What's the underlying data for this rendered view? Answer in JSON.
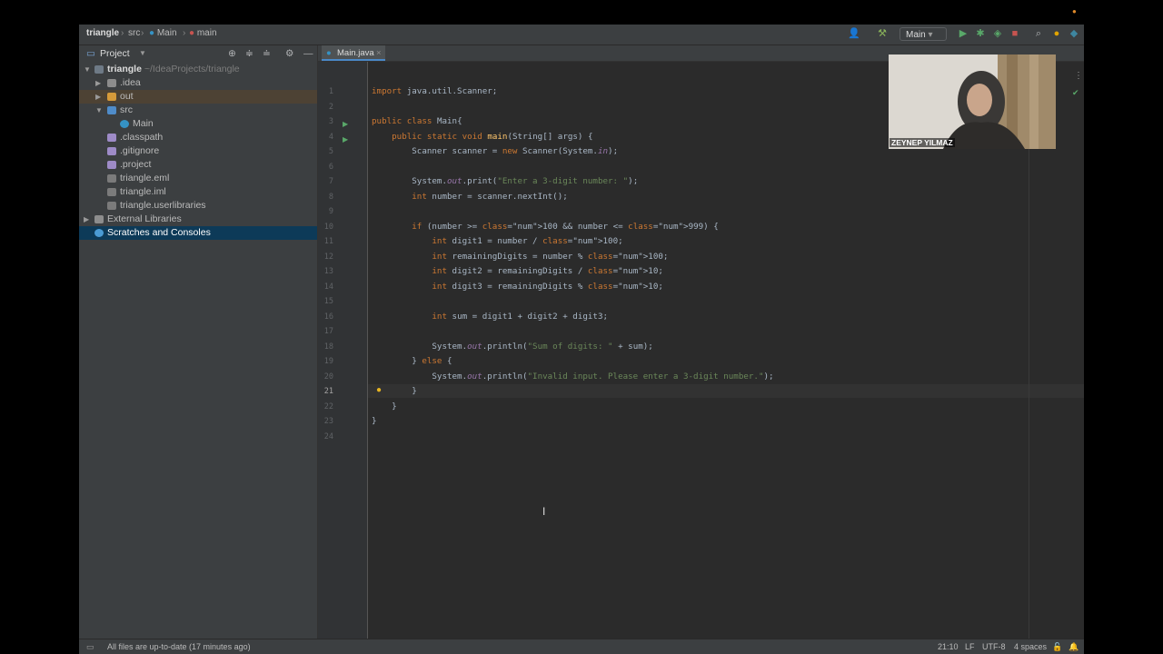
{
  "breadcrumb": {
    "project": "triangle",
    "folder": "src",
    "class": "Main",
    "method": "main"
  },
  "toolbar": {
    "run_config": "Main"
  },
  "sidebar": {
    "title": "Project",
    "items": [
      {
        "label": "triangle",
        "path": "~/IdeaProjects/triangle"
      },
      {
        "label": ".idea"
      },
      {
        "label": "out"
      },
      {
        "label": "src"
      },
      {
        "label": "Main"
      },
      {
        "label": ".classpath"
      },
      {
        "label": ".gitignore"
      },
      {
        "label": ".project"
      },
      {
        "label": "triangle.eml"
      },
      {
        "label": "triangle.iml"
      },
      {
        "label": "triangle.userlibraries"
      },
      {
        "label": "External Libraries"
      },
      {
        "label": "Scratches and Consoles"
      }
    ]
  },
  "editor": {
    "tab": "Main.java",
    "line_numbers": [
      "1",
      "2",
      "3",
      "4",
      "5",
      "6",
      "7",
      "8",
      "9",
      "10",
      "11",
      "12",
      "13",
      "14",
      "15",
      "16",
      "17",
      "18",
      "19",
      "20",
      "21",
      "22",
      "23",
      "24"
    ],
    "lines": [
      "import java.util.Scanner;",
      "",
      "public class Main{",
      "    public static void main(String[] args) {",
      "        Scanner scanner = new Scanner(System.in);",
      "",
      "        System.out.print(\"Enter a 3-digit number: \");",
      "        int number = scanner.nextInt();",
      "",
      "        if (number >= 100 && number <= 999) {",
      "            int digit1 = number / 100;",
      "            int remainingDigits = number % 100;",
      "            int digit2 = remainingDigits / 10;",
      "            int digit3 = remainingDigits % 10;",
      "",
      "            int sum = digit1 + digit2 + digit3;",
      "",
      "            System.out.println(\"Sum of digits: \" + sum);",
      "        } else {",
      "            System.out.println(\"Invalid input. Please enter a 3-digit number.\");",
      "        }",
      "    }",
      "}",
      ""
    ]
  },
  "statusbar": {
    "message": "All files are up-to-date (17 minutes ago)",
    "position": "21:10",
    "line_sep": "LF",
    "encoding": "UTF-8",
    "indent": "4 spaces"
  },
  "webcam": {
    "name": "ZEYNEP YILMAZ"
  }
}
